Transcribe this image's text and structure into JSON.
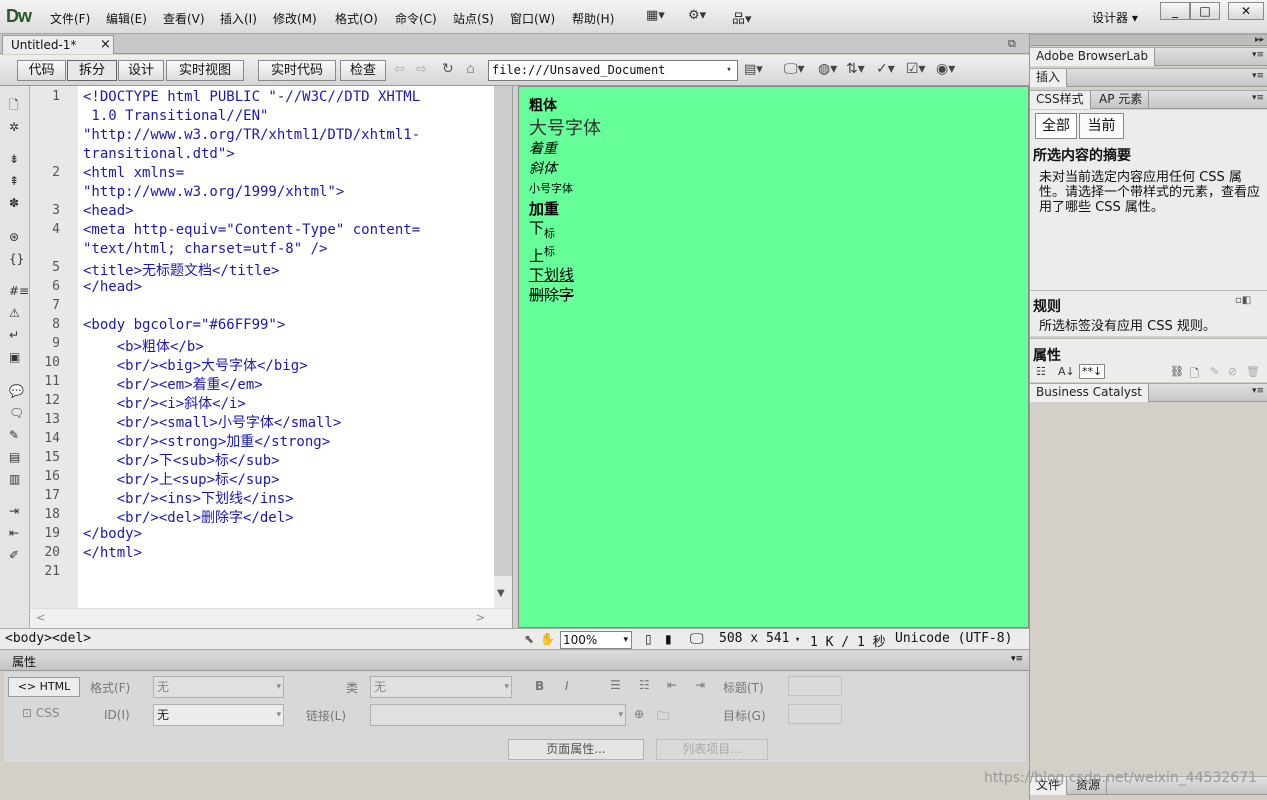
{
  "app": {
    "logo": "Dw",
    "workspace": "设计器",
    "workspace_arrow": "▾"
  },
  "menus": [
    "文件(F)",
    "编辑(E)",
    "查看(V)",
    "插入(I)",
    "修改(M)",
    "格式(O)",
    "命令(C)",
    "站点(S)",
    "窗口(W)",
    "帮助(H)"
  ],
  "window_buttons": [
    "_",
    "□",
    "✕"
  ],
  "document_tab": {
    "title": "Untitled-1*",
    "close": "×"
  },
  "view_buttons": {
    "code": "代码",
    "split": "拆分",
    "design": "设计",
    "live_view": "实时视图",
    "live_code": "实时代码",
    "inspect": "检查"
  },
  "address": {
    "value": "file:///Unsaved_Document",
    "arrow": "▾"
  },
  "code_lines": [
    {
      "n": "1",
      "text": "<!DOCTYPE html PUBLIC \"-//W3C//DTD XHTML"
    },
    {
      "n": "",
      "text": " 1.0 Transitional//EN\""
    },
    {
      "n": "",
      "text": "\"http://www.w3.org/TR/xhtml1/DTD/xhtml1-"
    },
    {
      "n": "",
      "text": "transitional.dtd\">"
    },
    {
      "n": "2",
      "text": "<html xmlns="
    },
    {
      "n": "",
      "text": "\"http://www.w3.org/1999/xhtml\">"
    },
    {
      "n": "3",
      "text": "<head>"
    },
    {
      "n": "4",
      "text": "<meta http-equiv=\"Content-Type\" content="
    },
    {
      "n": "",
      "text": "\"text/html; charset=utf-8\" />"
    },
    {
      "n": "5",
      "text": "<title>无标题文档</title>"
    },
    {
      "n": "6",
      "text": "</head>"
    },
    {
      "n": "7",
      "text": ""
    },
    {
      "n": "8",
      "text": "<body bgcolor=\"#66FF99\">"
    },
    {
      "n": "9",
      "text": "    <b>粗体</b>"
    },
    {
      "n": "10",
      "text": "    <br/><big>大号字体</big>"
    },
    {
      "n": "11",
      "text": "    <br/><em>着重</em>"
    },
    {
      "n": "12",
      "text": "    <br/><i>斜体</i>"
    },
    {
      "n": "13",
      "text": "    <br/><small>小号字体</small>"
    },
    {
      "n": "14",
      "text": "    <br/><strong>加重</strong>"
    },
    {
      "n": "15",
      "text": "    <br/>下<sub>标</sub>"
    },
    {
      "n": "16",
      "text": "    <br/>上<sup>标</sup>"
    },
    {
      "n": "17",
      "text": "    <br/><ins>下划线</ins>"
    },
    {
      "n": "18",
      "text": "    <br/><del>删除字</del>"
    },
    {
      "n": "19",
      "text": "</body>"
    },
    {
      "n": "20",
      "text": "</html>"
    },
    {
      "n": "21",
      "text": ""
    }
  ],
  "design_view": {
    "bold": "粗体",
    "big": "大号字体",
    "em": "着重",
    "italic": "斜体",
    "small": "小号字体",
    "strong": "加重",
    "sub_base": "下",
    "sub_text": "标",
    "sup_base": "上",
    "sup_text": "标",
    "ins": "下划线",
    "del": "删除字",
    "bgcolor": "#66FF99"
  },
  "status": {
    "tag_selector": "<body><del>",
    "zoom": "100%",
    "dimensions": "508 x 541",
    "size_time": "1 K / 1 秒",
    "encoding": "Unicode (UTF-8)"
  },
  "properties": {
    "title": "属性",
    "html_btn": "<> HTML",
    "css_btn": "CSS",
    "format_label": "格式(F)",
    "format_value": "无",
    "id_label": "ID(I)",
    "id_value": "无",
    "class_label": "类",
    "class_value": "无",
    "link_label": "链接(L)",
    "title_label": "标题(T)",
    "target_label": "目标(G)",
    "page_props": "页面属性...",
    "list_item": "列表项目..."
  },
  "right_panel": {
    "browserlab": "Adobe BrowserLab",
    "insert": "插入",
    "css_tab": "CSS样式",
    "ap_tab": "AP 元素",
    "all": "全部",
    "current": "当前",
    "summary_title": "所选内容的摘要",
    "summary_text": "未对当前选定内容应用任何 CSS 属性。请选择一个带样式的元素，查看应用了哪些 CSS 属性。",
    "rules_title": "规则",
    "rules_text": "所选标签没有应用 CSS 规则。",
    "props_title": "属性",
    "bc": "Business Catalyst",
    "files_tab": "文件",
    "assets_tab": "资源"
  },
  "watermark": "https://blog.csdn.net/weixin_44532671"
}
